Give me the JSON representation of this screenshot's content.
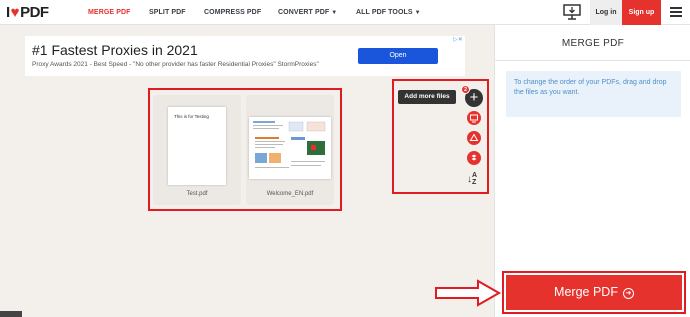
{
  "header": {
    "logo_left": "I",
    "logo_right": "PDF",
    "nav": [
      "MERGE PDF",
      "SPLIT PDF",
      "COMPRESS PDF",
      "CONVERT PDF",
      "ALL PDF TOOLS"
    ],
    "login": "Log in",
    "signup": "Sign up"
  },
  "ad": {
    "title": "#1 Fastest Proxies in 2021",
    "subtitle": "Proxy Awards 2021 - Best Speed - \"No other provider has faster Residential Proxies\" StormProxies\"",
    "button": "Open"
  },
  "files": [
    {
      "name": "Test.pdf",
      "page_text": "This is for Testing"
    },
    {
      "name": "Welcome_EN.pdf",
      "page_text": ""
    }
  ],
  "tools": {
    "tooltip": "Add more files",
    "count": "2",
    "sort_top": "A",
    "sort_bottom": "Z"
  },
  "sidebar": {
    "title": "MERGE PDF",
    "info": "To change the order of your PDFs, drag and drop the files as you want.",
    "merge_button": "Merge PDF"
  },
  "colors": {
    "brand": "#e5322d",
    "annotation": "#e01b22"
  }
}
